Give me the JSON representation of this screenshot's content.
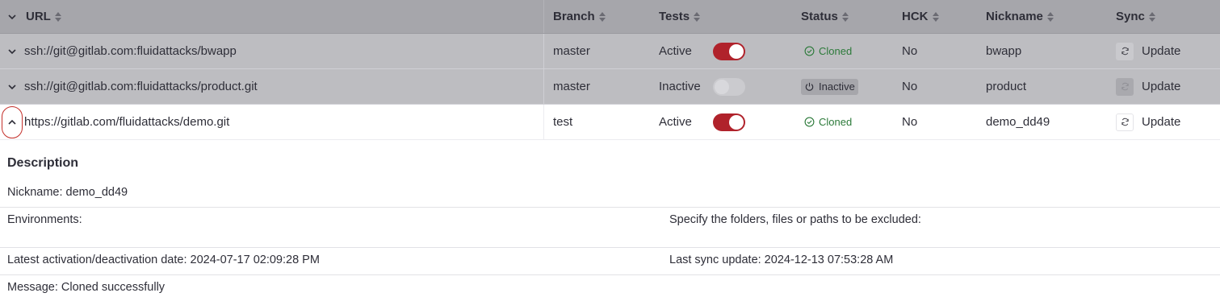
{
  "table": {
    "columns": [
      "URL",
      "Branch",
      "Tests",
      "Status",
      "HCK",
      "Nickname",
      "Sync"
    ],
    "rows": [
      {
        "url": "ssh://git@gitlab.com:fluidattacks/bwapp",
        "branch": "master",
        "tests": "Active",
        "tests_enabled": true,
        "status": "Cloned",
        "hck": "No",
        "nickname": "bwapp",
        "sync": "Update",
        "expanded": false
      },
      {
        "url": "ssh://git@gitlab.com:fluidattacks/product.git",
        "branch": "master",
        "tests": "Inactive",
        "tests_enabled": false,
        "status": "Inactive",
        "hck": "No",
        "nickname": "product",
        "sync": "Update",
        "expanded": false
      },
      {
        "url": "https://gitlab.com/fluidattacks/demo.git",
        "branch": "test",
        "tests": "Active",
        "tests_enabled": true,
        "status": "Cloned",
        "hck": "No",
        "nickname": "demo_dd49",
        "sync": "Update",
        "expanded": true
      }
    ]
  },
  "description": {
    "title": "Description",
    "nickname": "Nickname: demo_dd49",
    "environments": "Environments:",
    "excluded": "Specify the folders, files or paths to be excluded:",
    "latest_activation": "Latest activation/deactivation date: 2024-07-17 02:09:28 PM",
    "last_sync": "Last sync update: 2024-12-13 07:53:28 AM",
    "message": "Message: Cloned successfully"
  },
  "colors": {
    "toggle_on": "#b0222b",
    "status_cloned": "#2c7a3a",
    "expand_outline": "#c4302b"
  },
  "icons": {
    "expand": "chevron-down-icon",
    "collapse": "chevron-up-icon",
    "sort": "sort-icon",
    "cloned": "check-circle-icon",
    "inactive": "power-icon",
    "sync": "refresh-icon"
  }
}
